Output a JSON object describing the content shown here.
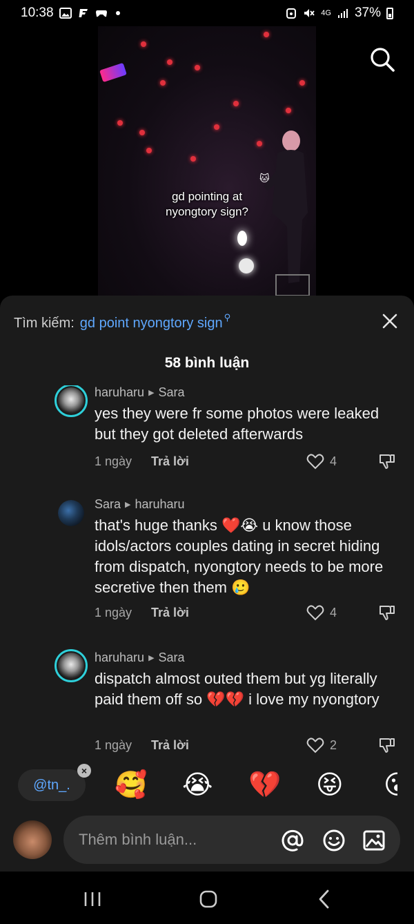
{
  "status": {
    "time": "10:38",
    "network": "4G",
    "battery": "37%"
  },
  "video": {
    "caption_line1": "gd pointing at",
    "caption_line2": "nyongtory sign?"
  },
  "search": {
    "prefix": "Tìm kiếm:",
    "query": "gd point nyongtory sign"
  },
  "comments_header": {
    "count_label": "58 bình luận"
  },
  "comments": [
    {
      "author": "haruharu",
      "reply_to": "Sara",
      "text": "yes they were fr some photos were leaked but they got deleted afterwards",
      "date": "1 ngày",
      "reply_label": "Trả lời",
      "likes": "4"
    },
    {
      "author": "Sara",
      "reply_to": "haruharu",
      "text": "that's huge thanks ❤️😭 u know those idols/actors couples dating in secret hiding from dispatch, nyongtory needs to be more secretive then them 🥲",
      "date": "1 ngày",
      "reply_label": "Trả lời",
      "likes": "4"
    },
    {
      "author": "haruharu",
      "reply_to": "Sara",
      "text": "dispatch almost outed them but yg literally paid them off so 💔💔 i love my nyongtory",
      "date": "1 ngày",
      "reply_label": "Trả lời",
      "likes": "2"
    }
  ],
  "mention_chip": {
    "label": "@tn_."
  },
  "emojis": [
    "🥰",
    "😭",
    "💔",
    "😝",
    "😮"
  ],
  "composer": {
    "placeholder": "Thêm bình luận..."
  },
  "colors": {
    "accent_blue": "#5fa8ff",
    "avatar_ring": "#2ecfd9",
    "sheet_bg": "#1b1b1b"
  }
}
